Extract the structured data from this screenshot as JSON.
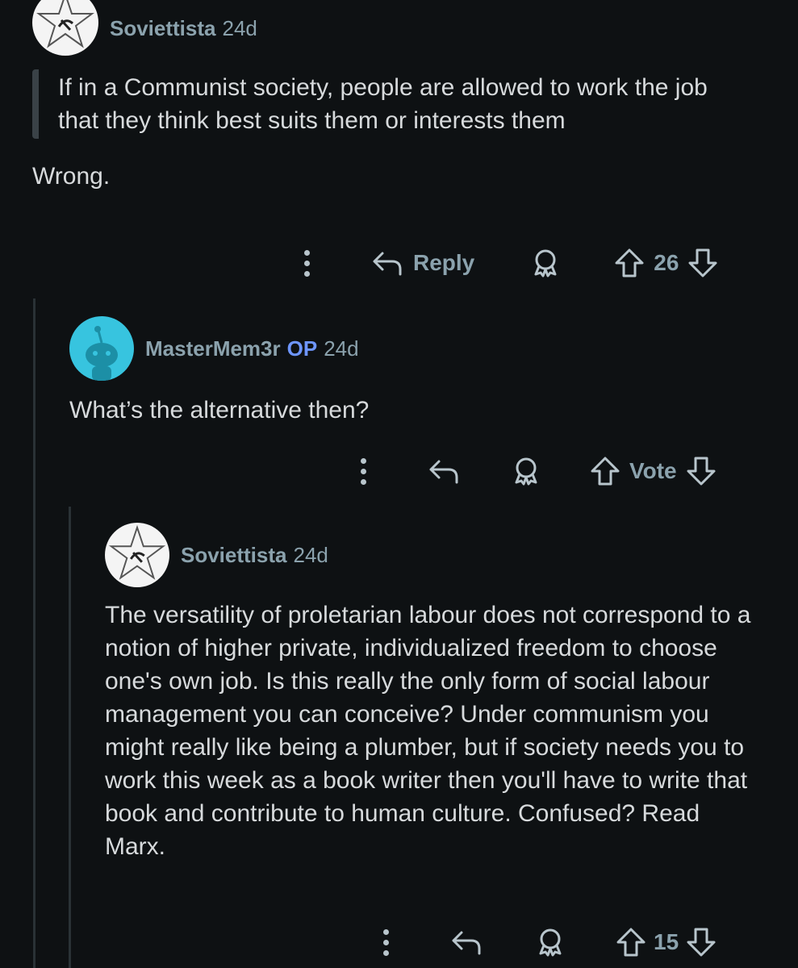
{
  "comments": [
    {
      "author": "Soviettista",
      "age": "24d",
      "quote": "If in a Communist society, people are allowed to work the job that they think best suits them or interests them",
      "body": "Wrong.",
      "actions": {
        "reply_label": "Reply",
        "vote_label": "26"
      }
    },
    {
      "author": "MasterMem3r",
      "op_badge": "OP",
      "age": "24d",
      "body": "What’s the alternative then?",
      "actions": {
        "vote_label": "Vote"
      }
    },
    {
      "author": "Soviettista",
      "age": "24d",
      "body": "The versatility of proletarian labour does not correspond to a notion of higher private, individualized freedom to choose one's own job. Is this really the only form of social labour management you can conceive? Under communism you might really like being a plumber, but if society needs you to work this week as a book writer then you'll have to write that book and contribute to human culture. Confused? Read Marx.",
      "actions": {
        "vote_label": "15"
      }
    }
  ],
  "icons": {
    "more": "more-options-icon",
    "reply": "reply-arrow-icon",
    "award": "award-icon",
    "upvote": "upvote-arrow-icon",
    "downvote": "downvote-arrow-icon"
  },
  "colors": {
    "background": "#0e1113",
    "meta_text": "#8ba2ad",
    "body_text": "#d7dadc",
    "op_badge": "#6e96ff",
    "snoo_avatar": "#37c4df"
  }
}
